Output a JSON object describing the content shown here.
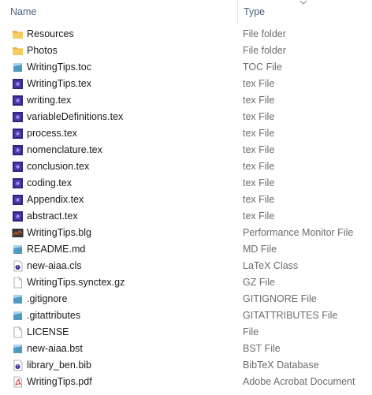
{
  "columns": {
    "name": "Name",
    "type": "Type"
  },
  "files": [
    {
      "name": "Resources",
      "type": "File folder",
      "icon": "folder-icon"
    },
    {
      "name": "Photos",
      "type": "File folder",
      "icon": "folder-icon"
    },
    {
      "name": "WritingTips.toc",
      "type": "TOC File",
      "icon": "generic-file-icon"
    },
    {
      "name": "WritingTips.tex",
      "type": "tex File",
      "icon": "tex-file-icon"
    },
    {
      "name": "writing.tex",
      "type": "tex File",
      "icon": "tex-file-icon"
    },
    {
      "name": "variableDefinitions.tex",
      "type": "tex File",
      "icon": "tex-file-icon"
    },
    {
      "name": "process.tex",
      "type": "tex File",
      "icon": "tex-file-icon"
    },
    {
      "name": "nomenclature.tex",
      "type": "tex File",
      "icon": "tex-file-icon"
    },
    {
      "name": "conclusion.tex",
      "type": "tex File",
      "icon": "tex-file-icon"
    },
    {
      "name": "coding.tex",
      "type": "tex File",
      "icon": "tex-file-icon"
    },
    {
      "name": "Appendix.tex",
      "type": "tex File",
      "icon": "tex-file-icon"
    },
    {
      "name": "abstract.tex",
      "type": "tex File",
      "icon": "tex-file-icon"
    },
    {
      "name": "WritingTips.blg",
      "type": "Performance Monitor File",
      "icon": "perfmon-file-icon"
    },
    {
      "name": "README.md",
      "type": "MD File",
      "icon": "generic-file-icon"
    },
    {
      "name": "new-aiaa.cls",
      "type": "LaTeX Class",
      "icon": "latex-class-icon"
    },
    {
      "name": "WritingTips.synctex.gz",
      "type": "GZ File",
      "icon": "blank-file-icon"
    },
    {
      "name": ".gitignore",
      "type": "GITIGNORE File",
      "icon": "generic-file-icon"
    },
    {
      "name": ".gitattributes",
      "type": "GITATTRIBUTES File",
      "icon": "generic-file-icon"
    },
    {
      "name": "LICENSE",
      "type": "File",
      "icon": "blank-file-icon"
    },
    {
      "name": "new-aiaa.bst",
      "type": "BST File",
      "icon": "generic-file-icon"
    },
    {
      "name": "library_ben.bib",
      "type": "BibTeX Database",
      "icon": "latex-class-icon"
    },
    {
      "name": "WritingTips.pdf",
      "type": "Adobe Acrobat Document",
      "icon": "pdf-file-icon"
    }
  ],
  "colors": {
    "folder": "#f2c55c",
    "tex": "#3a2a8c",
    "generic": "#5fa7c9",
    "pdf": "#d9302c",
    "header_text": "#4c607a",
    "type_text": "#6d6d6d"
  }
}
